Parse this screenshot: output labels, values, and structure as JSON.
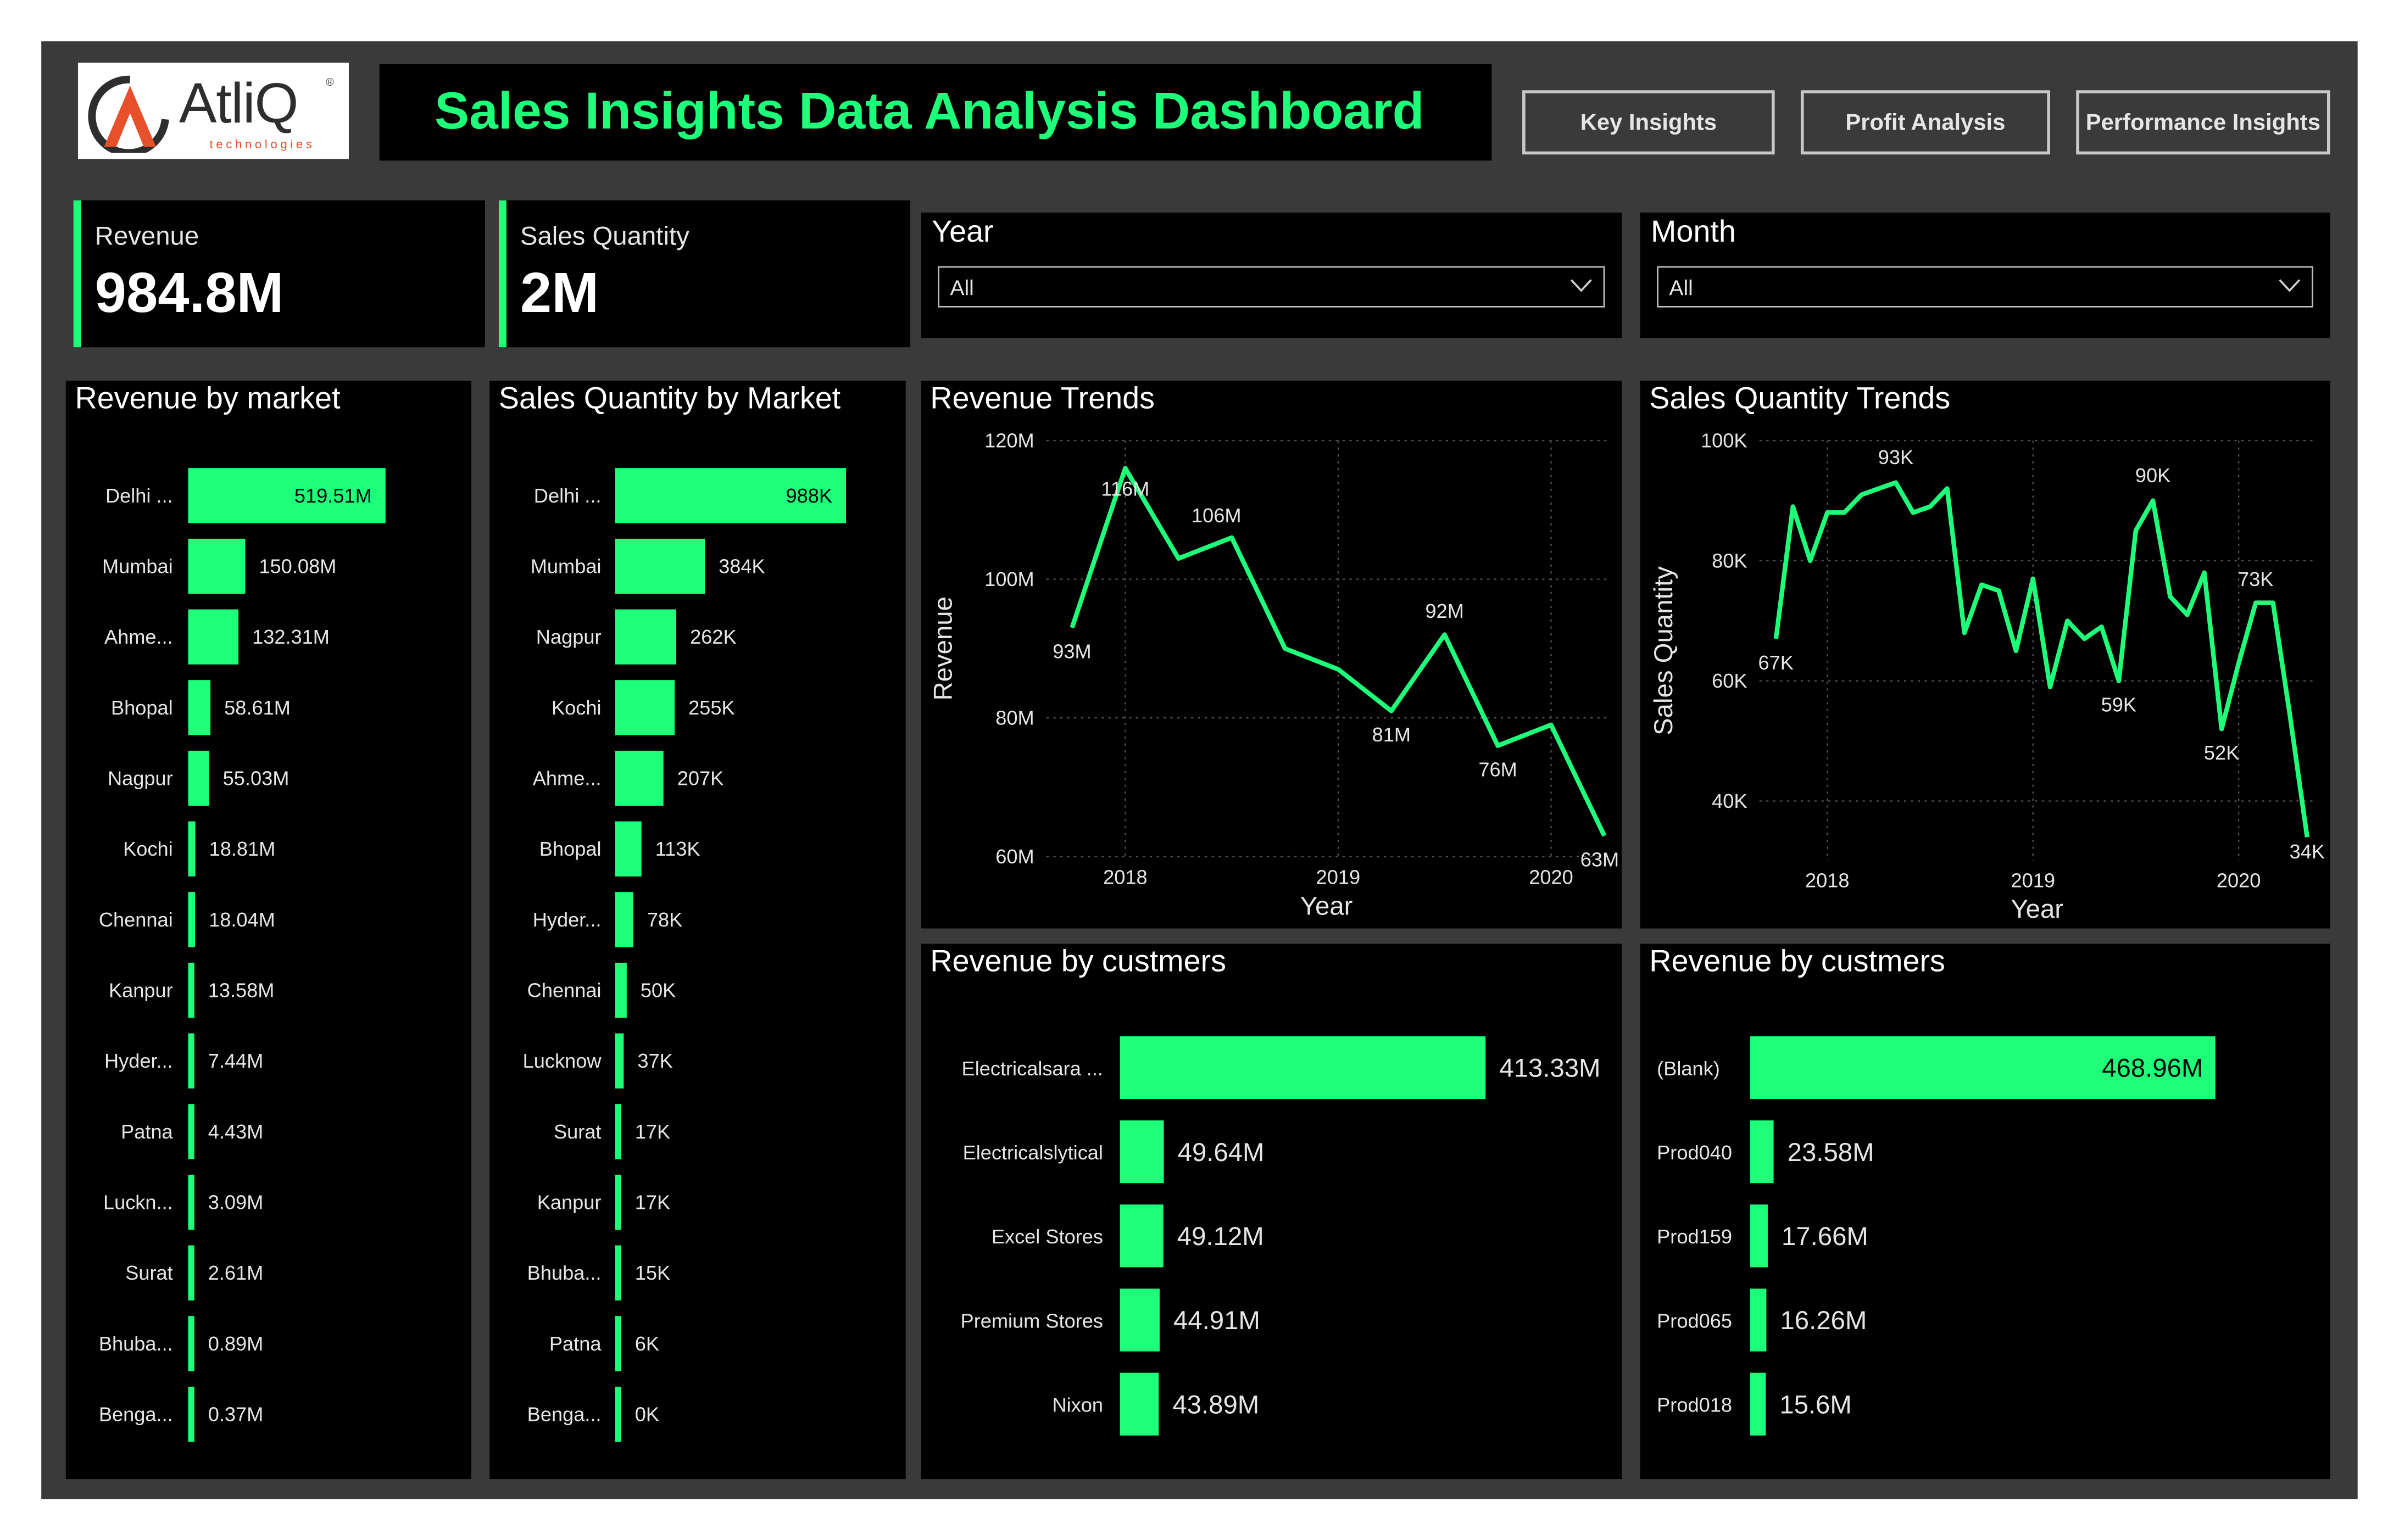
{
  "header": {
    "logo_text": "AtliQ",
    "logo_sub": "technologies",
    "logo_reg": "®",
    "title": "Sales Insights Data Analysis Dashboard",
    "nav": [
      "Key Insights",
      "Profit Analysis",
      "Performance Insights"
    ]
  },
  "kpis": [
    {
      "label": "Revenue",
      "value": "984.8M"
    },
    {
      "label": "Sales Quantity",
      "value": "2M"
    }
  ],
  "slicers": [
    {
      "label": "Year",
      "value": "All",
      "icon": "chevron-down-icon"
    },
    {
      "label": "Month",
      "value": "All",
      "icon": "chevron-down-icon"
    }
  ],
  "colors": {
    "accent": "#1eff7a",
    "frame": "#3a3a3a",
    "panel": "#000000",
    "text": "#e6e6e6"
  },
  "chart_data": [
    {
      "id": "rev_market",
      "type": "bar",
      "orientation": "horizontal",
      "title": "Revenue by market",
      "categories": [
        "Delhi ...",
        "Mumbai",
        "Ahme...",
        "Bhopal",
        "Nagpur",
        "Kochi",
        "Chennai",
        "Kanpur",
        "Hyder...",
        "Patna",
        "Luckn...",
        "Surat",
        "Bhuba...",
        "Benga..."
      ],
      "values": [
        519.51,
        150.08,
        132.31,
        58.61,
        55.03,
        18.81,
        18.04,
        13.58,
        7.44,
        4.43,
        3.09,
        2.61,
        0.89,
        0.37
      ],
      "labels": [
        "519.51M",
        "150.08M",
        "132.31M",
        "58.61M",
        "55.03M",
        "18.81M",
        "18.04M",
        "13.58M",
        "7.44M",
        "4.43M",
        "3.09M",
        "2.61M",
        "0.89M",
        "0.37M"
      ],
      "unit": "M"
    },
    {
      "id": "qty_market",
      "type": "bar",
      "orientation": "horizontal",
      "title": "Sales Quantity by Market",
      "categories": [
        "Delhi ...",
        "Mumbai",
        "Nagpur",
        "Kochi",
        "Ahme...",
        "Bhopal",
        "Hyder...",
        "Chennai",
        "Lucknow",
        "Surat",
        "Kanpur",
        "Bhuba...",
        "Patna",
        "Benga..."
      ],
      "values": [
        988,
        384,
        262,
        255,
        207,
        113,
        78,
        50,
        37,
        17,
        17,
        15,
        6,
        0
      ],
      "labels": [
        "988K",
        "384K",
        "262K",
        "255K",
        "207K",
        "113K",
        "78K",
        "50K",
        "37K",
        "17K",
        "17K",
        "15K",
        "6K",
        "0K"
      ],
      "unit": "K"
    },
    {
      "id": "rev_trend",
      "type": "line",
      "title": "Revenue Trends",
      "xlabel": "Year",
      "ylabel": "Revenue",
      "x_ticks": [
        "2018",
        "2019",
        "2020"
      ],
      "x_tick_positions": [
        2018,
        2019,
        2020
      ],
      "y_ticks": [
        "60M",
        "80M",
        "100M",
        "120M"
      ],
      "ylim": [
        60,
        120
      ],
      "x": [
        2017.75,
        2018.0,
        2018.25,
        2018.5,
        2018.75,
        2019.0,
        2019.25,
        2019.5,
        2019.75,
        2020.0,
        2020.25
      ],
      "values": [
        93,
        116,
        103,
        106,
        90,
        87,
        81,
        92,
        76,
        79,
        63
      ],
      "point_labels": [
        "93M",
        "116M",
        "",
        "106M",
        "",
        "",
        "81M",
        "92M",
        "76M",
        "",
        "63M"
      ]
    },
    {
      "id": "qty_trend",
      "type": "line",
      "title": "Sales Quantity Trends",
      "xlabel": "Year",
      "ylabel": "Sales Quantity",
      "x_ticks": [
        "2018",
        "2019",
        "2020"
      ],
      "x_tick_positions": [
        2018,
        2019,
        2020
      ],
      "y_ticks": [
        "40K",
        "60K",
        "80K",
        "100K"
      ],
      "ylim": [
        30,
        100
      ],
      "x": [
        2017.75,
        2017.833,
        2017.917,
        2018.0,
        2018.083,
        2018.167,
        2018.25,
        2018.333,
        2018.417,
        2018.5,
        2018.583,
        2018.667,
        2018.75,
        2018.833,
        2018.917,
        2019.0,
        2019.083,
        2019.167,
        2019.25,
        2019.333,
        2019.417,
        2019.5,
        2019.583,
        2019.667,
        2019.75,
        2019.833,
        2019.917,
        2020.0,
        2020.083,
        2020.167,
        2020.25,
        2020.333
      ],
      "values": [
        67,
        89,
        80,
        88,
        88,
        91,
        92,
        93,
        88,
        89,
        92,
        68,
        76,
        75,
        65,
        77,
        59,
        70,
        67,
        69,
        60,
        85,
        90,
        74,
        71,
        78,
        52,
        63,
        73,
        73,
        54,
        34
      ],
      "point_labels": [
        "67K",
        "",
        "",
        "",
        "",
        "",
        "",
        "93K",
        "",
        "",
        "",
        "",
        "",
        "",
        "",
        "",
        "",
        "",
        "",
        "",
        "59K",
        "",
        "90K",
        "",
        "",
        "",
        "52K",
        "",
        "73K",
        "",
        "",
        "34K"
      ]
    },
    {
      "id": "rev_customers",
      "type": "bar",
      "orientation": "horizontal",
      "title": "Revenue by custmers",
      "categories": [
        "Electricalsara ...",
        "Electricalslytical",
        "Excel Stores",
        "Premium Stores",
        "Nixon"
      ],
      "values": [
        413.33,
        49.64,
        49.12,
        44.91,
        43.89
      ],
      "labels": [
        "413.33M",
        "49.64M",
        "49.12M",
        "44.91M",
        "43.89M"
      ],
      "unit": "M"
    },
    {
      "id": "rev_products",
      "type": "bar",
      "orientation": "horizontal",
      "title": "Revenue by custmers",
      "categories": [
        "(Blank)",
        "Prod040",
        "Prod159",
        "Prod065",
        "Prod018"
      ],
      "values": [
        468.96,
        23.58,
        17.66,
        16.26,
        15.6
      ],
      "labels": [
        "468.96M",
        "23.58M",
        "17.66M",
        "16.26M",
        "15.6M"
      ],
      "unit": "M"
    }
  ]
}
